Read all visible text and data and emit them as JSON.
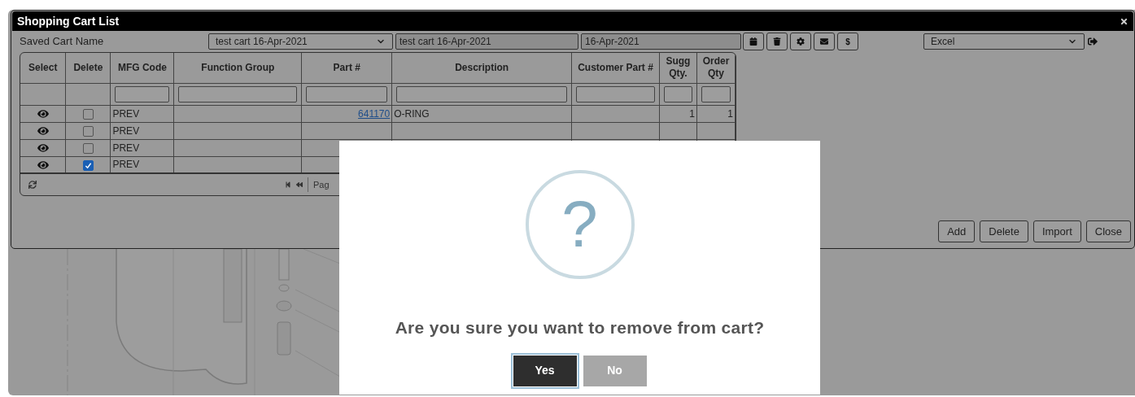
{
  "window": {
    "title": "Shopping Cart List"
  },
  "toolbar": {
    "label": "Saved Cart Name",
    "cart_select": "test cart 16-Apr-2021",
    "cart_name": "test cart 16-Apr-2021",
    "date": "16-Apr-2021",
    "price_button": "$",
    "export_select": "Excel"
  },
  "table": {
    "columns": [
      "Select",
      "Delete",
      "MFG Code",
      "Function Group",
      "Part #",
      "Description",
      "Customer Part #",
      "Sugg Qty.",
      "Order Qty"
    ],
    "rows": [
      {
        "mfg_code": "PREV",
        "part": "641170",
        "description": "O-RING",
        "sugg_qty": "1",
        "order_qty": "1",
        "delete_checked": false
      },
      {
        "mfg_code": "PREV",
        "delete_checked": false
      },
      {
        "mfg_code": "PREV",
        "delete_checked": false
      },
      {
        "mfg_code": "PREV",
        "delete_checked": true
      }
    ],
    "pager": "Pag"
  },
  "actions": [
    "Add",
    "Delete",
    "Import",
    "Close"
  ],
  "dialog": {
    "icon": "?",
    "message": "Are you sure you want to remove from cart?",
    "buttons": [
      {
        "label": "Yes",
        "kind": "primary"
      },
      {
        "label": "No",
        "kind": "secondary"
      }
    ]
  }
}
